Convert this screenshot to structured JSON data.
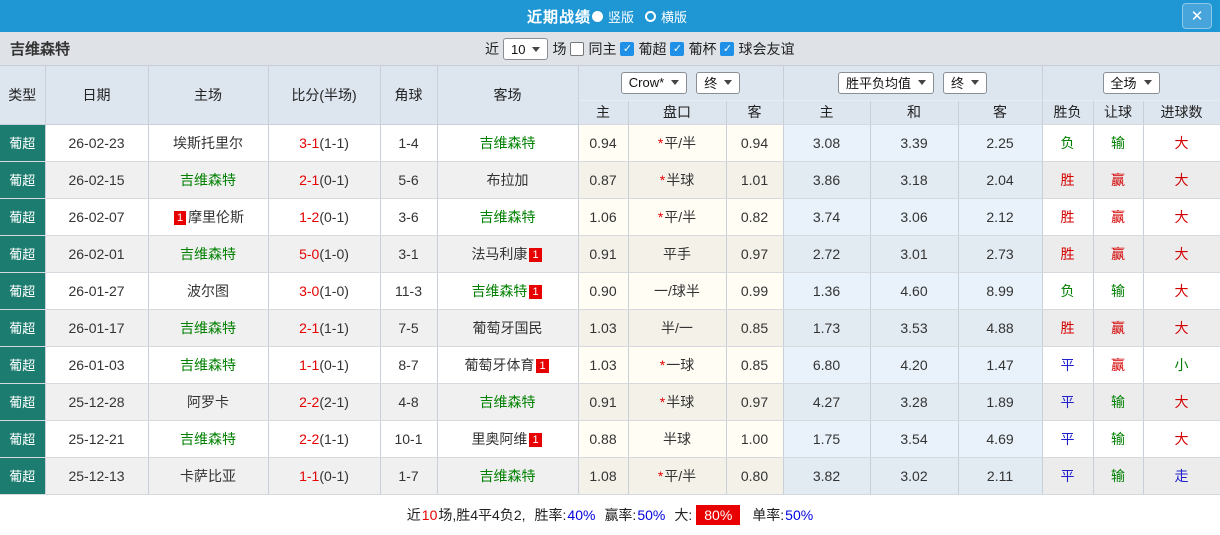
{
  "titlebar": {
    "title": "近期战绩",
    "radio_vertical": "竖版",
    "radio_horizontal": "横版",
    "close_label": "✕"
  },
  "filterbar": {
    "team": "吉维森特",
    "near_label": "近",
    "count_value": "10",
    "games_label": "场",
    "same_home_label": "同主",
    "league_filters": [
      "葡超",
      "葡杯",
      "球会友谊"
    ]
  },
  "table": {
    "dropdowns": {
      "company": "Crow*",
      "time1": "终",
      "avg": "胜平负均值",
      "time2": "终",
      "scope": "全场"
    },
    "headers": {
      "type": "类型",
      "date": "日期",
      "home": "主场",
      "score": "比分(半场)",
      "corner": "角球",
      "away": "客场",
      "odds_home": "主",
      "odds_line": "盘口",
      "odds_away": "客",
      "avg_home": "主",
      "avg_draw": "和",
      "avg_away": "客",
      "wdl": "胜负",
      "handicap": "让球",
      "goals": "进球数"
    },
    "rows": [
      {
        "league": "葡超",
        "date": "26-02-23",
        "home": "埃斯托里尔",
        "home_green": false,
        "home_badge": "",
        "score": "3-1",
        "half": "(1-1)",
        "corner": "1-4",
        "away": "吉维森特",
        "away_green": true,
        "away_badge": "",
        "odds_home": "0.94",
        "line_star": "*",
        "line": "平/半",
        "odds_away": "0.94",
        "avg_home": "3.08",
        "avg_draw": "3.39",
        "avg_away": "2.25",
        "wdl": "负",
        "wdl_color": "green",
        "handicap": "输",
        "handicap_color": "green",
        "goals": "大",
        "goals_color": "red"
      },
      {
        "league": "葡超",
        "date": "26-02-15",
        "home": "吉维森特",
        "home_green": true,
        "home_badge": "",
        "score": "2-1",
        "half": "(0-1)",
        "corner": "5-6",
        "away": "布拉加",
        "away_green": false,
        "away_badge": "",
        "odds_home": "0.87",
        "line_star": "*",
        "line": "半球",
        "odds_away": "1.01",
        "avg_home": "3.86",
        "avg_draw": "3.18",
        "avg_away": "2.04",
        "wdl": "胜",
        "wdl_color": "red",
        "handicap": "赢",
        "handicap_color": "red",
        "goals": "大",
        "goals_color": "red"
      },
      {
        "league": "葡超",
        "date": "26-02-07",
        "home": "摩里伦斯",
        "home_green": false,
        "home_badge": "1",
        "score": "1-2",
        "half": "(0-1)",
        "corner": "3-6",
        "away": "吉维森特",
        "away_green": true,
        "away_badge": "",
        "odds_home": "1.06",
        "line_star": "*",
        "line": "平/半",
        "odds_away": "0.82",
        "avg_home": "3.74",
        "avg_draw": "3.06",
        "avg_away": "2.12",
        "wdl": "胜",
        "wdl_color": "red",
        "handicap": "赢",
        "handicap_color": "red",
        "goals": "大",
        "goals_color": "red"
      },
      {
        "league": "葡超",
        "date": "26-02-01",
        "home": "吉维森特",
        "home_green": true,
        "home_badge": "",
        "score": "5-0",
        "half": "(1-0)",
        "corner": "3-1",
        "away": "法马利康",
        "away_green": false,
        "away_badge": "1",
        "odds_home": "0.91",
        "line_star": "",
        "line": "平手",
        "odds_away": "0.97",
        "avg_home": "2.72",
        "avg_draw": "3.01",
        "avg_away": "2.73",
        "wdl": "胜",
        "wdl_color": "red",
        "handicap": "赢",
        "handicap_color": "red",
        "goals": "大",
        "goals_color": "red"
      },
      {
        "league": "葡超",
        "date": "26-01-27",
        "home": "波尔图",
        "home_green": false,
        "home_badge": "",
        "score": "3-0",
        "half": "(1-0)",
        "corner": "11-3",
        "away": "吉维森特",
        "away_green": true,
        "away_badge": "1",
        "odds_home": "0.90",
        "line_star": "",
        "line": "一/球半",
        "odds_away": "0.99",
        "avg_home": "1.36",
        "avg_draw": "4.60",
        "avg_away": "8.99",
        "wdl": "负",
        "wdl_color": "green",
        "handicap": "输",
        "handicap_color": "green",
        "goals": "大",
        "goals_color": "red"
      },
      {
        "league": "葡超",
        "date": "26-01-17",
        "home": "吉维森特",
        "home_green": true,
        "home_badge": "",
        "score": "2-1",
        "half": "(1-1)",
        "corner": "7-5",
        "away": "葡萄牙国民",
        "away_green": false,
        "away_badge": "",
        "odds_home": "1.03",
        "line_star": "",
        "line": "半/一",
        "odds_away": "0.85",
        "avg_home": "1.73",
        "avg_draw": "3.53",
        "avg_away": "4.88",
        "wdl": "胜",
        "wdl_color": "red",
        "handicap": "赢",
        "handicap_color": "red",
        "goals": "大",
        "goals_color": "red"
      },
      {
        "league": "葡超",
        "date": "26-01-03",
        "home": "吉维森特",
        "home_green": true,
        "home_badge": "",
        "score": "1-1",
        "half": "(0-1)",
        "corner": "8-7",
        "away": "葡萄牙体育",
        "away_green": false,
        "away_badge": "1",
        "odds_home": "1.03",
        "line_star": "*",
        "line": "一球",
        "odds_away": "0.85",
        "avg_home": "6.80",
        "avg_draw": "4.20",
        "avg_away": "1.47",
        "wdl": "平",
        "wdl_color": "blue",
        "handicap": "赢",
        "handicap_color": "red",
        "goals": "小",
        "goals_color": "green"
      },
      {
        "league": "葡超",
        "date": "25-12-28",
        "home": "阿罗卡",
        "home_green": false,
        "home_badge": "",
        "score": "2-2",
        "half": "(2-1)",
        "corner": "4-8",
        "away": "吉维森特",
        "away_green": true,
        "away_badge": "",
        "odds_home": "0.91",
        "line_star": "*",
        "line": "半球",
        "odds_away": "0.97",
        "avg_home": "4.27",
        "avg_draw": "3.28",
        "avg_away": "1.89",
        "wdl": "平",
        "wdl_color": "blue",
        "handicap": "输",
        "handicap_color": "green",
        "goals": "大",
        "goals_color": "red"
      },
      {
        "league": "葡超",
        "date": "25-12-21",
        "home": "吉维森特",
        "home_green": true,
        "home_badge": "",
        "score": "2-2",
        "half": "(1-1)",
        "corner": "10-1",
        "away": "里奥阿维",
        "away_green": false,
        "away_badge": "1",
        "odds_home": "0.88",
        "line_star": "",
        "line": "半球",
        "odds_away": "1.00",
        "avg_home": "1.75",
        "avg_draw": "3.54",
        "avg_away": "4.69",
        "wdl": "平",
        "wdl_color": "blue",
        "handicap": "输",
        "handicap_color": "green",
        "goals": "大",
        "goals_color": "red"
      },
      {
        "league": "葡超",
        "date": "25-12-13",
        "home": "卡萨比亚",
        "home_green": false,
        "home_badge": "",
        "score": "1-1",
        "half": "(0-1)",
        "corner": "1-7",
        "away": "吉维森特",
        "away_green": true,
        "away_badge": "",
        "odds_home": "1.08",
        "line_star": "*",
        "line": "平/半",
        "odds_away": "0.80",
        "avg_home": "3.82",
        "avg_draw": "3.02",
        "avg_away": "2.11",
        "wdl": "平",
        "wdl_color": "blue",
        "handicap": "输",
        "handicap_color": "green",
        "goals": "走",
        "goals_color": "blue"
      }
    ]
  },
  "footer": {
    "prefix": "近",
    "count": "10",
    "middle": "场,胜4平4负2, ",
    "win_rate_label": "胜率:",
    "win_rate": "40%",
    "handicap_rate_label": "赢率:",
    "handicap_rate": "50%",
    "big_label": "大:",
    "big_rate": "80%",
    "single_label": "单率:",
    "single_rate": "50%"
  }
}
